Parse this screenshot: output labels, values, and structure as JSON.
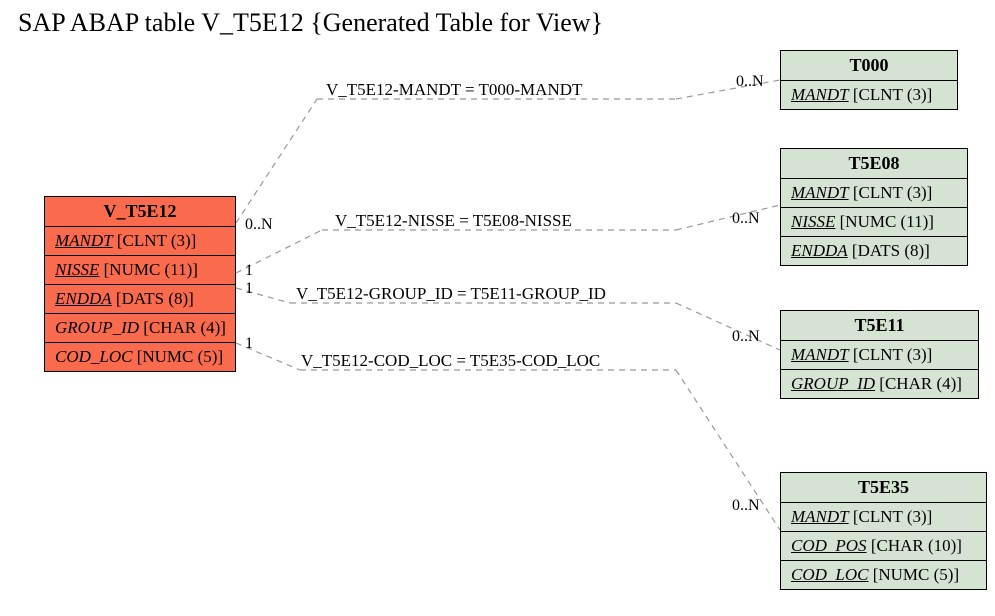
{
  "title": "SAP ABAP table V_T5E12 {Generated Table for View}",
  "source": {
    "name": "V_T5E12",
    "fields": [
      {
        "name": "MANDT",
        "type": "[CLNT (3)]",
        "key": true
      },
      {
        "name": "NISSE",
        "type": "[NUMC (11)]",
        "key": true
      },
      {
        "name": "ENDDA",
        "type": "[DATS (8)]",
        "key": true
      },
      {
        "name": "GROUP_ID",
        "type": "[CHAR (4)]",
        "key": false
      },
      {
        "name": "COD_LOC",
        "type": "[NUMC (5)]",
        "key": false
      }
    ]
  },
  "targets": [
    {
      "name": "T000",
      "fields": [
        {
          "name": "MANDT",
          "type": "[CLNT (3)]",
          "key": true
        }
      ]
    },
    {
      "name": "T5E08",
      "fields": [
        {
          "name": "MANDT",
          "type": "[CLNT (3)]",
          "key": true
        },
        {
          "name": "NISSE",
          "type": "[NUMC (11)]",
          "key": true
        },
        {
          "name": "ENDDA",
          "type": "[DATS (8)]",
          "key": true
        }
      ]
    },
    {
      "name": "T5E11",
      "fields": [
        {
          "name": "MANDT",
          "type": "[CLNT (3)]",
          "key": true
        },
        {
          "name": "GROUP_ID",
          "type": "[CHAR (4)]",
          "key": true
        }
      ]
    },
    {
      "name": "T5E35",
      "fields": [
        {
          "name": "MANDT",
          "type": "[CLNT (3)]",
          "key": true
        },
        {
          "name": "COD_POS",
          "type": "[CHAR (10)]",
          "key": true
        },
        {
          "name": "COD_LOC",
          "type": "[NUMC (5)]",
          "key": true
        }
      ]
    }
  ],
  "relations": [
    {
      "label": "V_T5E12-MANDT = T000-MANDT",
      "src_card": "0..N",
      "tgt_card": "0..N"
    },
    {
      "label": "V_T5E12-NISSE = T5E08-NISSE",
      "src_card": "1",
      "tgt_card": "0..N"
    },
    {
      "label": "V_T5E12-GROUP_ID = T5E11-GROUP_ID",
      "src_card": "1",
      "tgt_card": "0..N"
    },
    {
      "label": "V_T5E12-COD_LOC = T5E35-COD_LOC",
      "src_card": "1",
      "tgt_card": "0..N"
    }
  ]
}
